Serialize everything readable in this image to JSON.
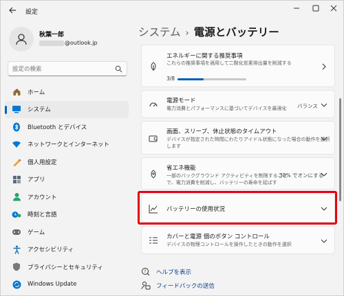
{
  "window": {
    "title": "設定"
  },
  "profile": {
    "name": "秋葉一郎",
    "email": "@outlook.jp"
  },
  "search": {
    "placeholder": "設定の検索"
  },
  "sidebar": {
    "items": [
      {
        "label": "ホーム",
        "icon": "home-icon"
      },
      {
        "label": "システム",
        "icon": "system-icon"
      },
      {
        "label": "Bluetooth とデバイス",
        "icon": "bluetooth-icon"
      },
      {
        "label": "ネットワークとインターネット",
        "icon": "network-icon"
      },
      {
        "label": "個人用設定",
        "icon": "personalization-icon"
      },
      {
        "label": "アプリ",
        "icon": "apps-icon"
      },
      {
        "label": "アカウント",
        "icon": "accounts-icon"
      },
      {
        "label": "時刻と言語",
        "icon": "time-language-icon"
      },
      {
        "label": "ゲーム",
        "icon": "gaming-icon"
      },
      {
        "label": "アクセシビリティ",
        "icon": "accessibility-icon"
      },
      {
        "label": "プライバシーとセキュリティ",
        "icon": "privacy-icon"
      },
      {
        "label": "Windows Update",
        "icon": "windows-update-icon"
      }
    ],
    "active_index": 1
  },
  "header": {
    "parent": "システム",
    "separator": "›",
    "current": "電源とバッテリー"
  },
  "cards": {
    "recommendations": {
      "title": "エネルギーに関する推奨事項",
      "desc": "これらの推奨事項を適用して二酸化炭素排出量を削減する",
      "progress_text": "3/8",
      "progress_fraction": 0.375
    },
    "power_mode": {
      "title": "電源モード",
      "desc": "電力消費とパフォーマンスに基づいてデバイスを最適化",
      "value": "バランス"
    },
    "screen_sleep": {
      "title": "画面、スリープ、休止状態のタイムアウト",
      "desc_line1": "デバイスが指定された時間にわたりアイドル状態になった場合の動作を選択",
      "desc_line2": "します"
    },
    "energy_saver": {
      "title": "省エネ機能",
      "desc_line1": "一部のバックグラウンド アクティビティを制限すること",
      "desc_line2": "で、電力消費を削減し、バッテリーの寿命を延ばす",
      "value": "30% でオンにする"
    },
    "battery_usage": {
      "title": "バッテリーの使用状況"
    },
    "lid_power": {
      "title": "カバーと電源 個のボタン コントロール",
      "desc": "デバイスの物理コントロールを操作したときの動作を選択"
    }
  },
  "footer": {
    "help": "ヘルプを表示",
    "feedback": "フィードバックの送信"
  },
  "colors": {
    "accent": "#005fb8",
    "highlight": "#e60012"
  }
}
